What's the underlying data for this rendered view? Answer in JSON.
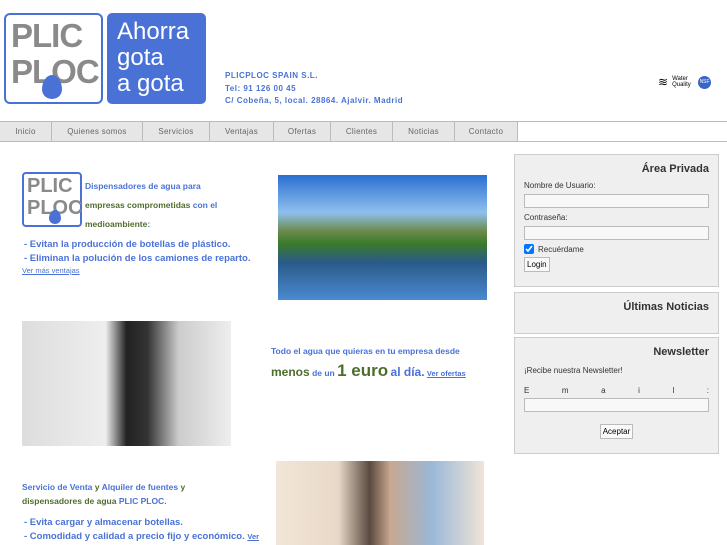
{
  "logo": {
    "line1": "PLIC",
    "line2": "PLOC",
    "slogan": [
      "Ahorra",
      "gota",
      "a gota"
    ]
  },
  "company": {
    "name": "PLICPLOC SPAIN S.L.",
    "phone": "Tel: 91 126 00 45",
    "address": "C/ Cobeña, 5, local. 28864. Ajalvir. Madrid"
  },
  "badges": {
    "water_quality": "Water Quality",
    "nsf": "NSF"
  },
  "nav": [
    "Inicio",
    "Quienes somos",
    "Servicios",
    "Ventajas",
    "Ofertas",
    "Clientes",
    "Noticias",
    "Contacto"
  ],
  "section1": {
    "t1": "Dispensadores de agua para",
    "t2": "empresas comprometidas",
    "t3": "con el",
    "t4": "medioambiente",
    "t5": ":",
    "b1": "- Evitan la producción de botellas de plástico.",
    "b2": "- Eliminan la polución de los camiones de reparto.",
    "link": "Ver más ventajas"
  },
  "section2": {
    "t1": "Todo el agua que quieras en tu empresa desde",
    "t2": "menos",
    "t3": "de un",
    "t4": "1 euro",
    "t5": "al día.",
    "link": "Ver ofertas"
  },
  "section3": {
    "t1": "Servicio de Venta",
    "t2": "y",
    "t3": "Alquiler de fuentes",
    "t4": "y",
    "t5": "dispensadores de agua",
    "t6": "PLIC PLOC.",
    "b1": "- Evita cargar y almacenar botellas.",
    "b2a": "- Comodidad",
    "b2b": "y",
    "b2c": "calidad",
    "b2d": "a",
    "b2e": "precio fijo",
    "b2f": "y",
    "b2g": "económico.",
    "link": "Ver"
  },
  "private": {
    "title": "Área Privada",
    "user_label": "Nombre de Usuario:",
    "pass_label": "Contraseña:",
    "remember": "Recuérdame",
    "login": "Login"
  },
  "news": {
    "title": "Últimas Noticias"
  },
  "newsletter": {
    "title": "Newsletter",
    "text": "¡Recibe nuestra Newsletter!",
    "email_label": [
      "E",
      "m",
      "a",
      "i",
      "l",
      ":"
    ],
    "submit": "Aceptar"
  }
}
